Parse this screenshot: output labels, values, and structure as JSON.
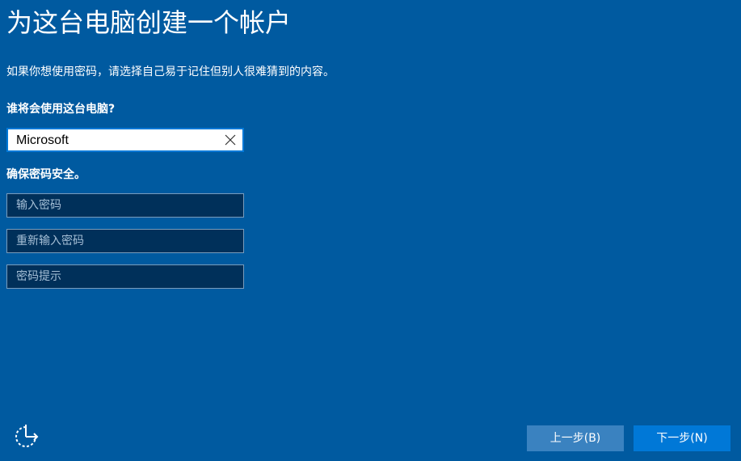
{
  "page": {
    "title": "为这台电脑创建一个帐户",
    "description": "如果你想使用密码，请选择自己易于记住但别人很难猜到的内容。"
  },
  "user_section": {
    "label": "谁将会使用这台电脑?",
    "username_value": "Microsoft"
  },
  "password_section": {
    "label": "确保密码安全。",
    "password_placeholder": "输入密码",
    "reenter_placeholder": "重新输入密码",
    "hint_placeholder": "密码提示"
  },
  "footer": {
    "back_label": "上一步(B)",
    "next_label": "下一步(N)"
  },
  "icons": {
    "clear": "close-icon",
    "accessibility": "ease-of-access-icon"
  },
  "colors": {
    "background": "#005aa0",
    "accent": "#0078d7",
    "input_dark": "#00305a",
    "back_button": "#3a82c0"
  }
}
